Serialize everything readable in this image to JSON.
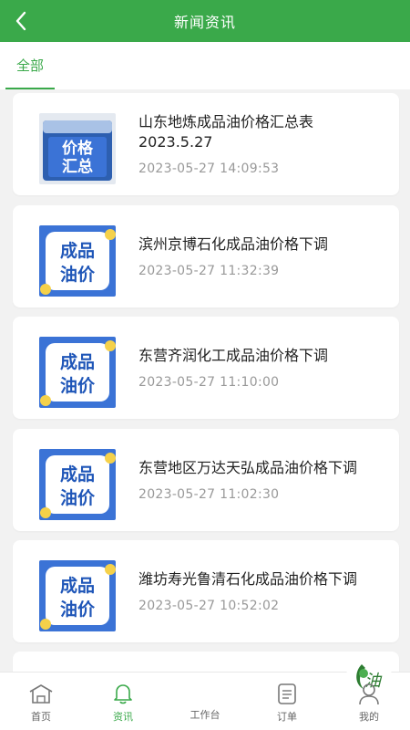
{
  "header": {
    "title": "新闻资讯"
  },
  "tabs": [
    {
      "label": "全部"
    }
  ],
  "news": [
    {
      "title": "山东地炼成品油价格汇总表2023.5.27",
      "time": "2023-05-27 14:09:53",
      "thumb_text": [
        "价格",
        "汇总"
      ],
      "thumb": "price-summary"
    },
    {
      "title": "滨州京博石化成品油价格下调",
      "time": "2023-05-27 11:32:39",
      "thumb_text": [
        "成品",
        "油价"
      ],
      "thumb": "oil-price"
    },
    {
      "title": "东营齐润化工成品油价格下调",
      "time": "2023-05-27 11:10:00",
      "thumb_text": [
        "成品",
        "油价"
      ],
      "thumb": "oil-price"
    },
    {
      "title": "东营地区万达天弘成品油价格下调",
      "time": "2023-05-27 11:02:30",
      "thumb_text": [
        "成品",
        "油价"
      ],
      "thumb": "oil-price"
    },
    {
      "title": "潍坊寿光鲁清石化成品油价格下调",
      "time": "2023-05-27 10:52:02",
      "thumb_text": [
        "成品",
        "油价"
      ],
      "thumb": "oil-price"
    }
  ],
  "tabbar": {
    "items": [
      {
        "label": "首页",
        "icon": "home-icon"
      },
      {
        "label": "资讯",
        "icon": "bell-icon"
      },
      {
        "label": "工作台",
        "icon": "oil-logo-icon",
        "logo_text": "油"
      },
      {
        "label": "订单",
        "icon": "orders-icon"
      },
      {
        "label": "我的",
        "icon": "user-icon"
      }
    ],
    "active": "资讯"
  },
  "colors": {
    "accent": "#3aa94a",
    "thumb_blue": "#3b73d6",
    "thumb_yellow": "#f5d14a"
  }
}
